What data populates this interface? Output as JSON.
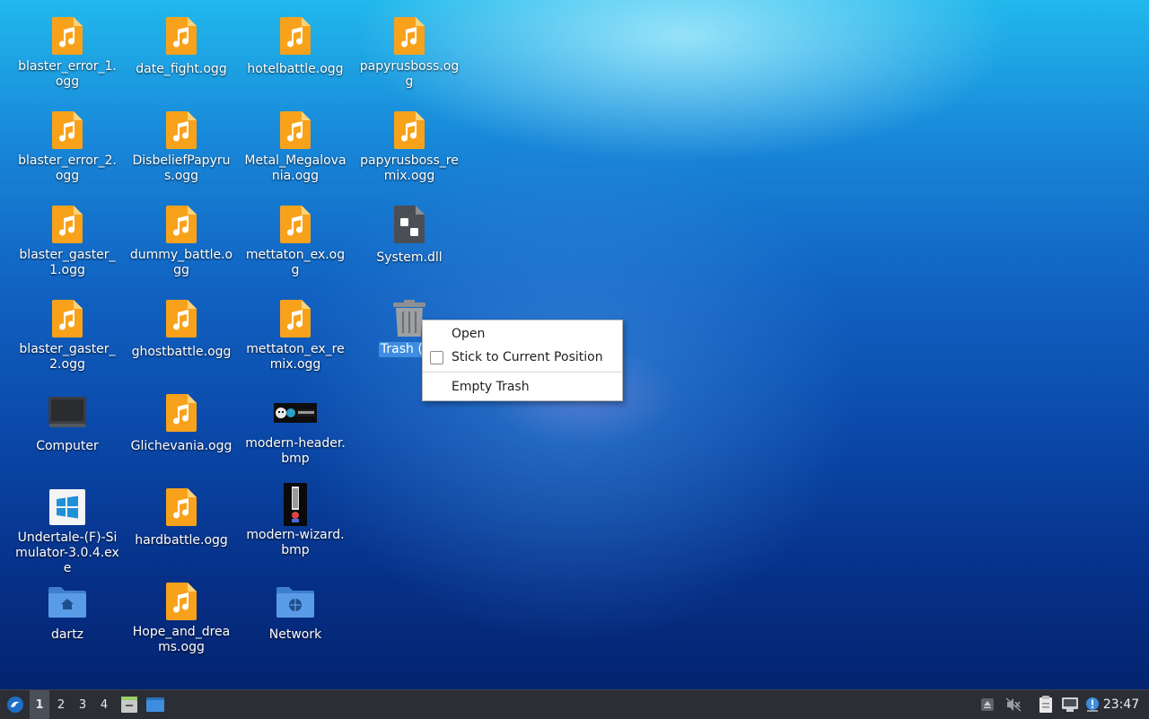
{
  "desktop": {
    "icons": [
      {
        "label": "blaster_error_1.ogg",
        "type": "audio"
      },
      {
        "label": "date_fight.ogg",
        "type": "audio"
      },
      {
        "label": "hotelbattle.ogg",
        "type": "audio"
      },
      {
        "label": "papyrusboss.ogg",
        "type": "audio"
      },
      {
        "label": "blaster_error_2.ogg",
        "type": "audio"
      },
      {
        "label": "DisbeliefPapyrus.ogg",
        "type": "audio"
      },
      {
        "label": "Metal_Megalovania.ogg",
        "type": "audio"
      },
      {
        "label": "papyrusboss_remix.ogg",
        "type": "audio"
      },
      {
        "label": "blaster_gaster_1.ogg",
        "type": "audio"
      },
      {
        "label": "dummy_battle.ogg",
        "type": "audio"
      },
      {
        "label": "mettaton_ex.ogg",
        "type": "audio"
      },
      {
        "label": "System.dll",
        "type": "library"
      },
      {
        "label": "blaster_gaster_2.ogg",
        "type": "audio"
      },
      {
        "label": "ghostbattle.ogg",
        "type": "audio"
      },
      {
        "label": "mettaton_ex_remix.ogg",
        "type": "audio"
      },
      {
        "label": "Trash (8 i",
        "type": "trash"
      },
      {
        "label": "Computer",
        "type": "computer"
      },
      {
        "label": "Glichevania.ogg",
        "type": "audio"
      },
      {
        "label": "modern-header.bmp",
        "type": "image"
      },
      {
        "label": "Undertale-(F)-Simulator-3.0.4.exe",
        "type": "exe"
      },
      {
        "label": "hardbattle.ogg",
        "type": "audio"
      },
      {
        "label": "modern-wizard.bmp",
        "type": "image"
      },
      {
        "label": "dartz",
        "type": "home-folder"
      },
      {
        "label": "Hope_and_dreams.ogg",
        "type": "audio"
      },
      {
        "label": "Network",
        "type": "network-folder"
      }
    ]
  },
  "context_menu": {
    "open": "Open",
    "stick": "Stick to Current Position",
    "empty_trash": "Empty Trash"
  },
  "taskbar": {
    "workspaces": [
      "1",
      "2",
      "3",
      "4"
    ],
    "active_workspace": "1",
    "clock": "23:47"
  },
  "colors": {
    "audio_icon": "#f8a21b",
    "selection": "#3d8ee0",
    "taskbar": "#2b2f35"
  }
}
